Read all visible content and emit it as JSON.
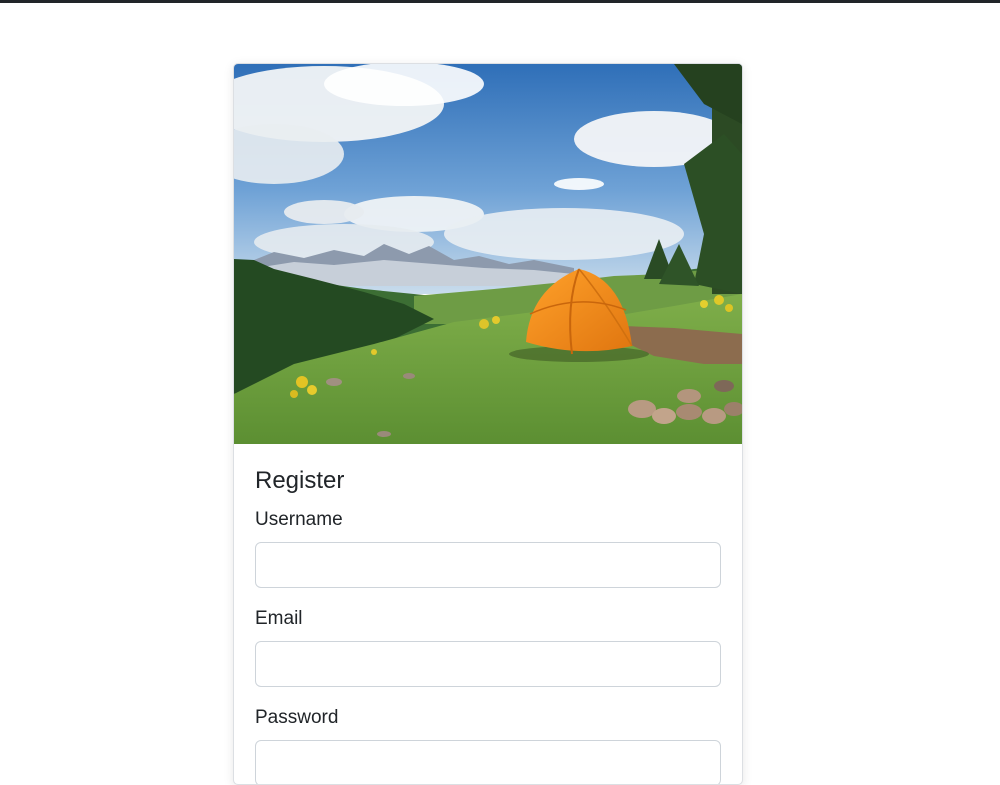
{
  "form": {
    "title": "Register",
    "fields": [
      {
        "label": "Username",
        "value": "",
        "placeholder": ""
      },
      {
        "label": "Email",
        "value": "",
        "placeholder": ""
      },
      {
        "label": "Password",
        "value": "",
        "placeholder": ""
      }
    ]
  },
  "image": {
    "subject": "orange-tent-mountain-meadow"
  },
  "colors": {
    "tent": "#f28a16",
    "sky": "#3f7fc4",
    "grass": "#6a9a3a",
    "topbar": "#212529"
  }
}
